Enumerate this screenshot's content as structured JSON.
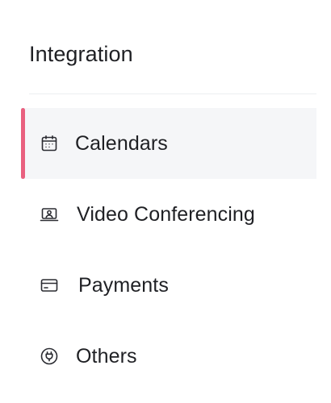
{
  "header": {
    "title": "Integration"
  },
  "menu": {
    "items": [
      {
        "label": "Calendars",
        "icon": "calendar-icon",
        "active": true
      },
      {
        "label": "Video Conferencing",
        "icon": "video-conferencing-icon",
        "active": false
      },
      {
        "label": "Payments",
        "icon": "credit-card-icon",
        "active": false
      },
      {
        "label": "Others",
        "icon": "plug-icon",
        "active": false
      }
    ]
  },
  "colors": {
    "accent": "#e9607f",
    "active_background": "#f5f6f8",
    "text": "#1f2024",
    "icon": "#2a2b31",
    "divider": "#eceef1"
  }
}
